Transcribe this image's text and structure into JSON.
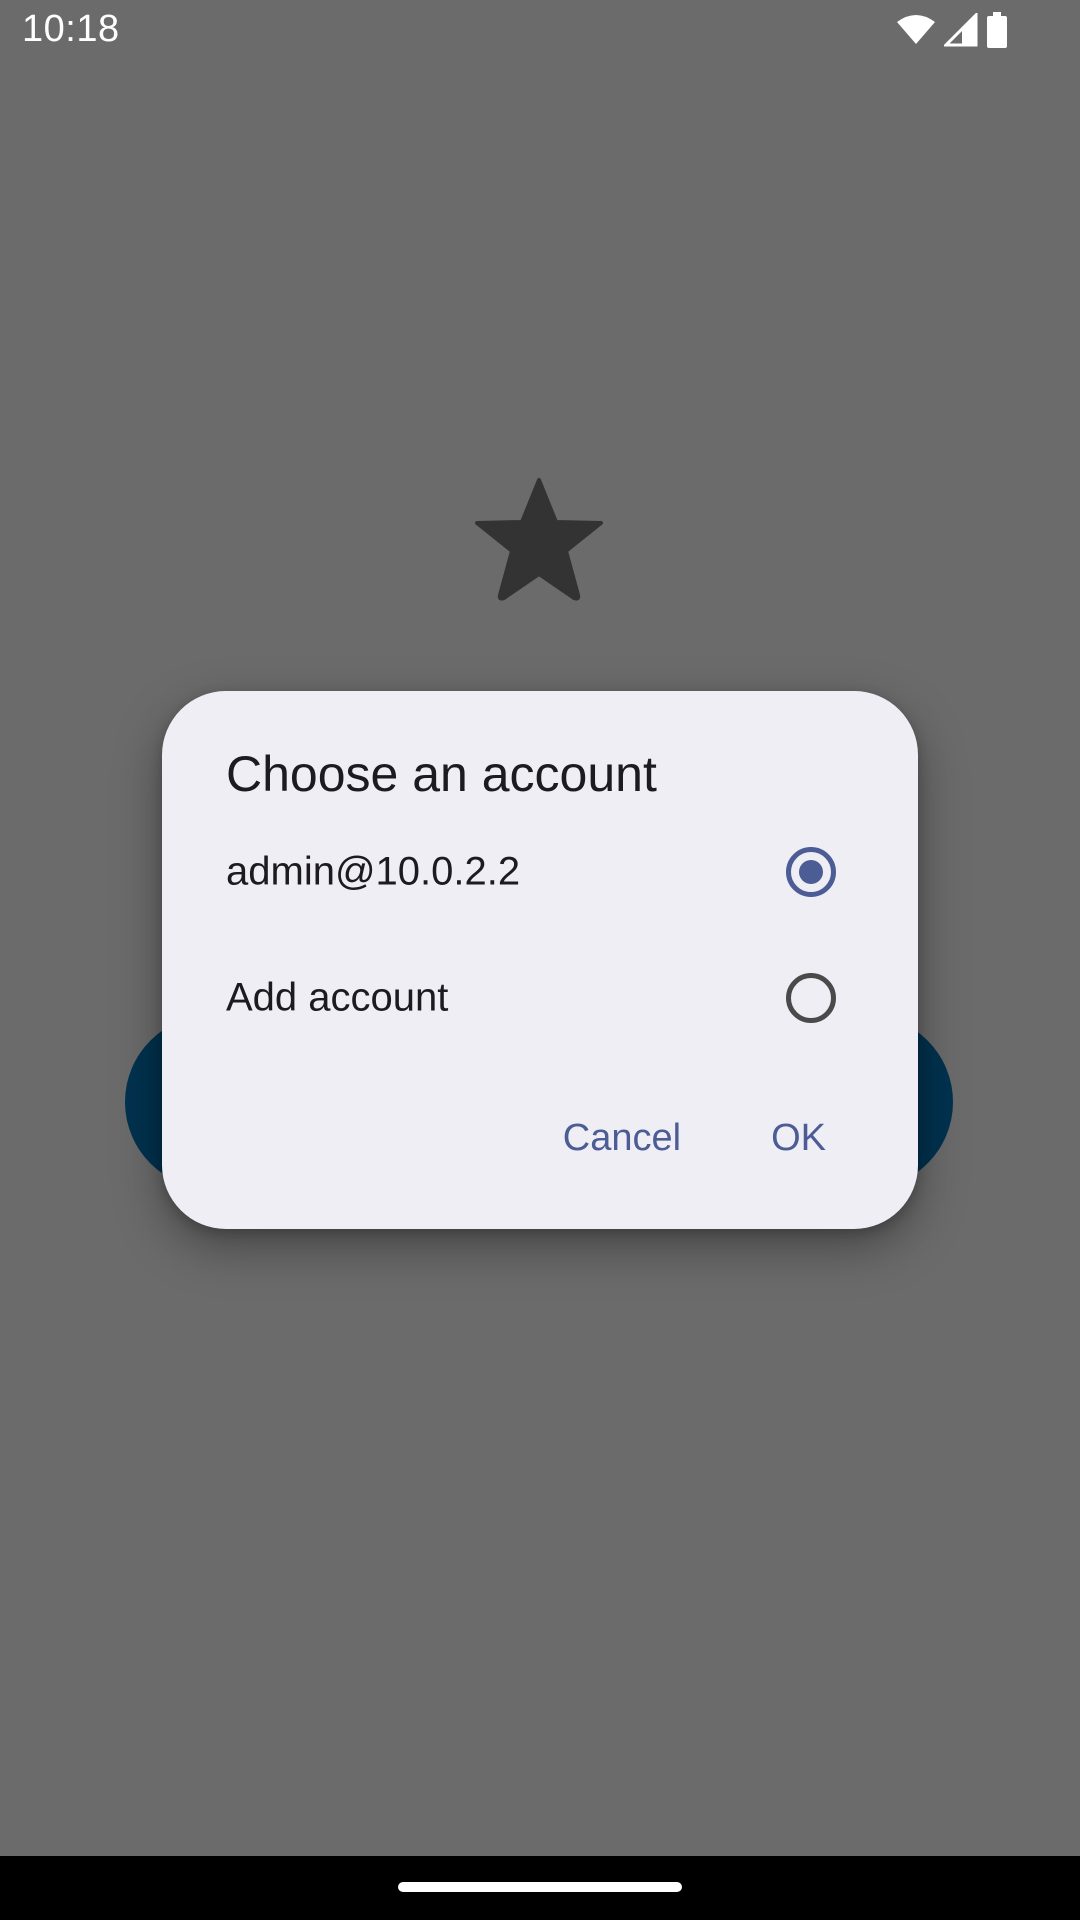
{
  "status_bar": {
    "time": "10:18",
    "icons": [
      "wifi-icon",
      "cell-signal-icon",
      "battery-icon"
    ]
  },
  "background": {
    "logo_icon": "star-icon",
    "colors": {
      "scrim": "#6b6b6b",
      "button": "#00324f"
    }
  },
  "dialog": {
    "title": "Choose an account",
    "options": [
      {
        "label": "admin@10.0.2.2",
        "selected": true
      },
      {
        "label": "Add account",
        "selected": false
      }
    ],
    "cancel_label": "Cancel",
    "ok_label": "OK",
    "colors": {
      "surface": "#f0eef5",
      "accent": "#4b5d94",
      "text": "#1c1b1f"
    }
  }
}
